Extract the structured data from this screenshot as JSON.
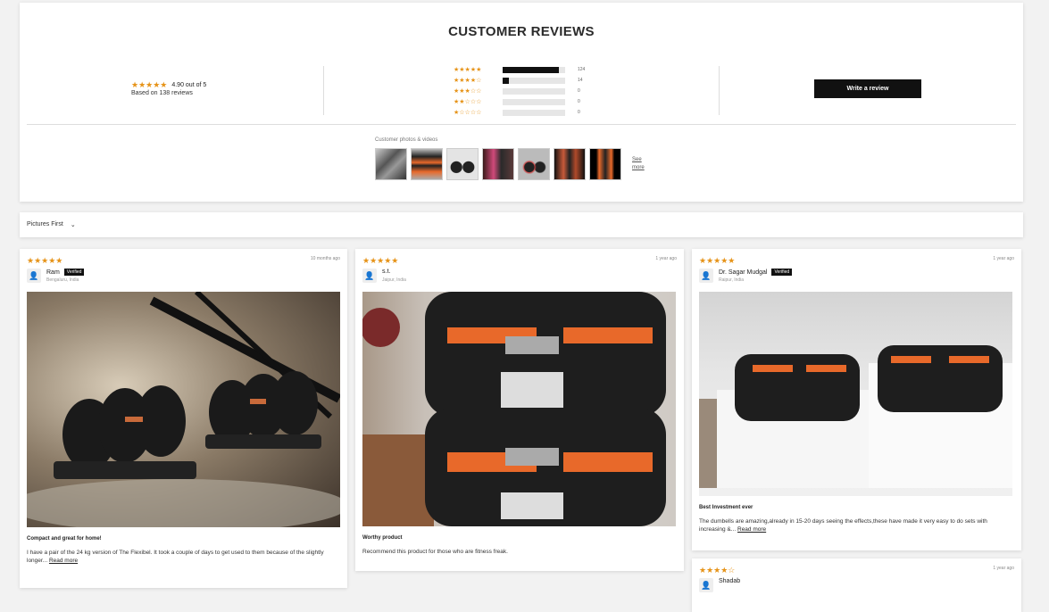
{
  "summary": {
    "title": "CUSTOMER REVIEWS",
    "average_text": "4.90 out of 5",
    "average_stars": "★★★★★",
    "based_on": "Based on 138 reviews",
    "histogram": [
      {
        "stars": "★★★★★",
        "count": "124",
        "fraction": 0.9
      },
      {
        "stars": "★★★★☆",
        "count": "14",
        "fraction": 0.1
      },
      {
        "stars": "★★★☆☆",
        "count": "0",
        "fraction": 0
      },
      {
        "stars": "★★☆☆☆",
        "count": "0",
        "fraction": 0
      },
      {
        "stars": "★☆☆☆☆",
        "count": "0",
        "fraction": 0
      }
    ],
    "write_review_label": "Write a review",
    "photos_label": "Customer photos & videos",
    "see_more_label": "See more"
  },
  "sort": {
    "label": "Pictures First",
    "chevron": "⌄"
  },
  "reviews": [
    {
      "stars": "★★★★★",
      "date": "10 months ago",
      "name": "Ram",
      "verified": "Verified",
      "location": "Bengaluru, India",
      "title": "Compact and great for home!",
      "body": "I have a pair of the 24 kg version of The Flexibel. It took a couple of days to get used to them because of the slightly longer...",
      "read_more": "Read more"
    },
    {
      "stars": "★★★★★",
      "date": "1 year ago",
      "name": "s.t.",
      "verified": "",
      "location": "Jaipur, India",
      "title": "Worthy product",
      "body": "Recommend this product for those who are fitness freak.",
      "read_more": ""
    },
    {
      "stars": "★★★★★",
      "date": "1 year ago",
      "name": "Dr. Sagar Mudgal",
      "verified": "Verified",
      "location": "Raipur, India",
      "title": "Best Investment ever",
      "body": "The dumbells are amazing,already in 15-20 days seeing the effects,these have made it very easy to do sets with increasing &...",
      "read_more": "Read more"
    },
    {
      "stars": "★★★★☆",
      "date": "1 year ago",
      "name": "Shadab",
      "verified": "",
      "location": "",
      "title": "",
      "body": "",
      "read_more": ""
    }
  ],
  "colors": {
    "star": "#e69318",
    "button": "#111111",
    "accent_orange": "#e8692a"
  },
  "icons": {
    "avatar": "user-icon",
    "chevron": "chevron-down-icon"
  }
}
